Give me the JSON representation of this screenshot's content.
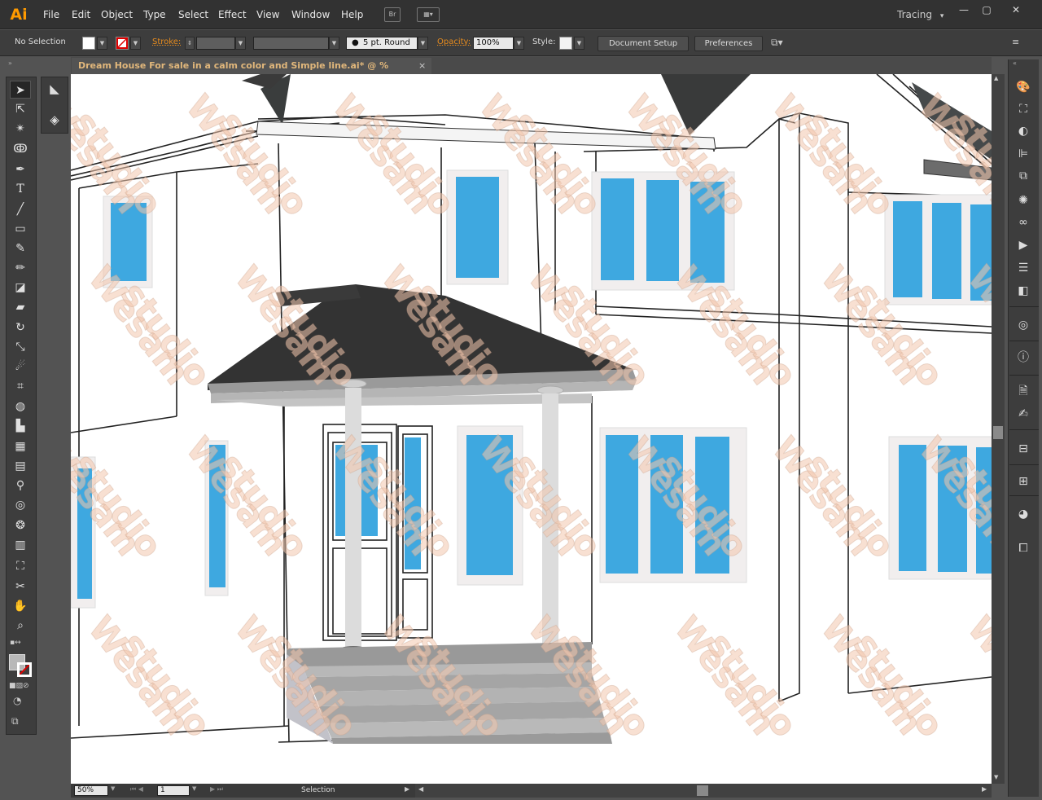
{
  "app": {
    "logo": "Ai"
  },
  "menu": [
    "File",
    "Edit",
    "Object",
    "Type",
    "Select",
    "Effect",
    "View",
    "Window",
    "Help"
  ],
  "header": {
    "bridge_icon": "bridge-icon",
    "arrange_icon": "arrange-documents-icon",
    "workspace": "Tracing",
    "workspace_arrow": "▾"
  },
  "window_controls": {
    "minimize": "—",
    "maximize": "▢",
    "close": "✕"
  },
  "control_bar": {
    "selection_status": "No Selection",
    "stroke_label": "Stroke:",
    "brush_label": "5 pt. Round",
    "opacity_label": "Opacity:",
    "opacity_value": "100%",
    "style_label": "Style:",
    "document_setup": "Document Setup",
    "preferences": "Preferences"
  },
  "document": {
    "tab_title": "Dream House For sale in a calm color and Simple line.ai* @ % (CMYK/Preview)",
    "close": "×"
  },
  "status": {
    "zoom": "50%",
    "artboard": "1",
    "tool": "Selection"
  },
  "watermark": {
    "line1": "Wesam",
    "line2": "studio"
  },
  "colors": {
    "window_glass": "#3ea8e0",
    "roof": "#333333",
    "accent": "#ff9a00"
  },
  "tools": [
    "selection-tool",
    "direct-selection-tool",
    "magic-wand-tool",
    "lasso-tool",
    "pen-tool",
    "type-tool",
    "line-tool",
    "rectangle-tool",
    "paintbrush-tool",
    "pencil-tool",
    "blob-brush-tool",
    "eraser-tool",
    "rotate-tool",
    "scale-tool",
    "warp-tool",
    "free-transform-tool",
    "shape-builder-tool",
    "perspective-grid-tool",
    "mesh-tool",
    "gradient-tool",
    "eyedropper-tool",
    "blend-tool",
    "symbol-sprayer-tool",
    "column-graph-tool",
    "artboard-tool",
    "slice-tool",
    "hand-tool",
    "zoom-tool"
  ],
  "panels": [
    "color-panel",
    "transform-panel",
    "appearance-panel",
    "align-panel",
    "pathfinder-panel",
    "symbols-panel",
    "links-panel",
    "actions-panel",
    "stroke-panel",
    "gradient-panel",
    "transparency-panel",
    "info-panel",
    "document-info-panel",
    "brushes-panel",
    "layers-panel",
    "artboards-panel",
    "navigator-panel",
    "graphic-styles-panel"
  ]
}
